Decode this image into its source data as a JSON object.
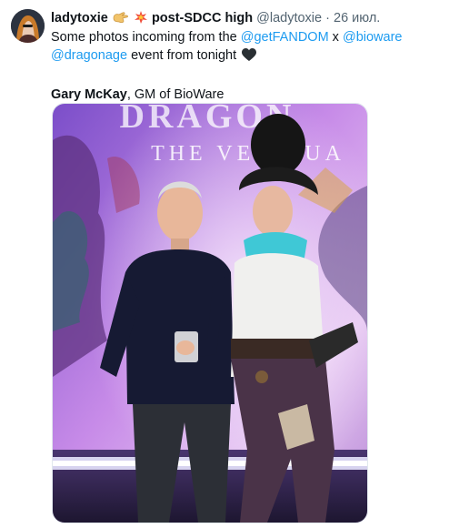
{
  "tweet": {
    "author_name": "ladytoxie",
    "author_name_suffix": "post-SDCC high",
    "handle": "@ladytoxie",
    "separator": "·",
    "timestamp": "26 июл.",
    "text_part1": "Some photos incoming from the ",
    "mention1": "@getFANDOM",
    "text_part2": " x ",
    "mention2": "@bioware",
    "text_part3": " ",
    "mention3": "@dragonage",
    "text_part4": " event from tonight",
    "caption_bold": "Gary McKay",
    "caption_rest": ", GM of BioWare",
    "photo_alt": "Two people posing in front of a Dragon Age: The Veilguard backdrop",
    "backdrop_title": "DRAGON",
    "backdrop_subtitle": "THE VEILGUA"
  },
  "colors": {
    "link": "#1d9bf0",
    "secondary_text": "#536471",
    "text": "#0f1419"
  },
  "icons": [
    "avatar-image",
    "hands-emoji-icon",
    "collision-emoji-icon",
    "black-heart-emoji-icon",
    "more-icon"
  ]
}
